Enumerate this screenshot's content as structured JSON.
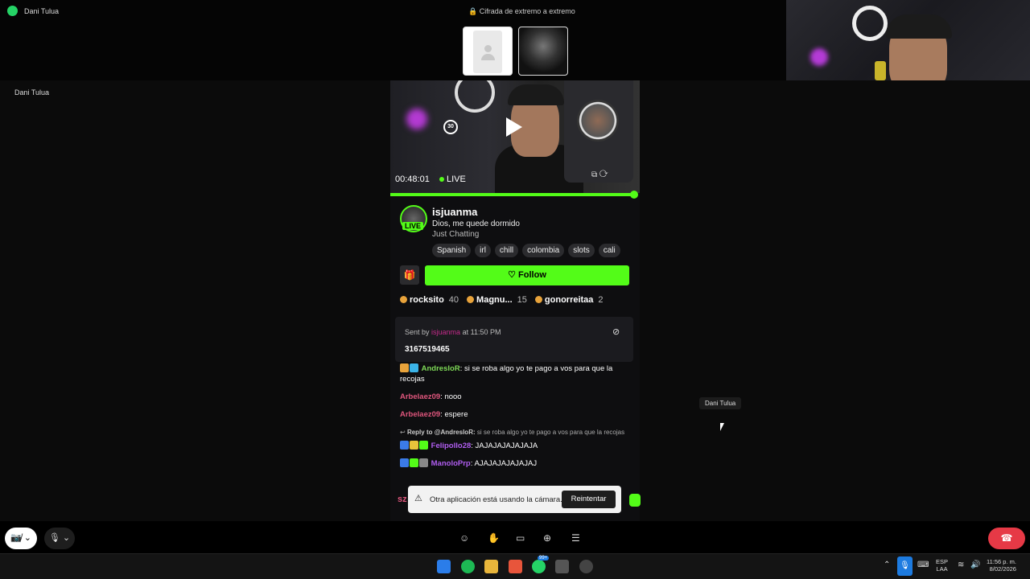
{
  "window": {
    "app_name": "Dani Tulua",
    "encryption_label": "Cifrada de extremo a extremo"
  },
  "call": {
    "caller_label": "Dani Tulua",
    "hover_tooltip": "Dani Tulua"
  },
  "stream": {
    "time": "00:48:01",
    "live_label": "LIVE",
    "replay_label": "30",
    "progress": 1.0,
    "streamer": "isjuanma",
    "avatar_badge": "LIVE",
    "title": "Dios, me quede dormido",
    "category": "Just Chatting",
    "tags": [
      "Spanish",
      "irl",
      "chill",
      "colombia",
      "slots",
      "cali"
    ],
    "follow_label": "Follow",
    "gift_icon": "gift-icon"
  },
  "leaderboard": [
    {
      "name": "rocksito",
      "count": "40"
    },
    {
      "name": "Magnu...",
      "count": "15"
    },
    {
      "name": "gonorreitaa",
      "count": "2"
    }
  ],
  "pinned": {
    "sent_by": "Sent by",
    "user": "isjuanma",
    "at": "at 11:50 PM",
    "message": "3167519465"
  },
  "chat": [
    {
      "user": "AndresloR",
      "text": "si se roba algo yo te pago a vos para que la recojas",
      "color": "#7ed957"
    },
    {
      "user": "Arbelaez09",
      "text": "nooo",
      "color": "#e0567d"
    },
    {
      "user": "Arbelaez09",
      "text": "espere",
      "color": "#e0567d"
    },
    {
      "reply_label": "Reply to @AndresloR:",
      "reply_text": "si se roba algo yo te pago a vos para que la recojas",
      "user": "Felipollo28",
      "text": "JAJAJAJAJAJAJA",
      "color": "#b15ef1"
    },
    {
      "user": "ManoloPrp",
      "text": "AJAJAJAJAJAJAJ",
      "color": "#b15ef1"
    }
  ],
  "chat_cut_user": "sz",
  "toast": {
    "text": "Otra aplicación está usando la cámara.",
    "button": "Reintentar"
  },
  "taskbar": {
    "lang_top": "ESP",
    "lang_bottom": "LAA",
    "time": "11:56 p. m.",
    "date": "8/02/2026",
    "whatsapp_badge": "99+"
  },
  "colors": {
    "accent": "#53fc18",
    "end_call": "#e63946",
    "pinned_user": "#c52a8a"
  }
}
